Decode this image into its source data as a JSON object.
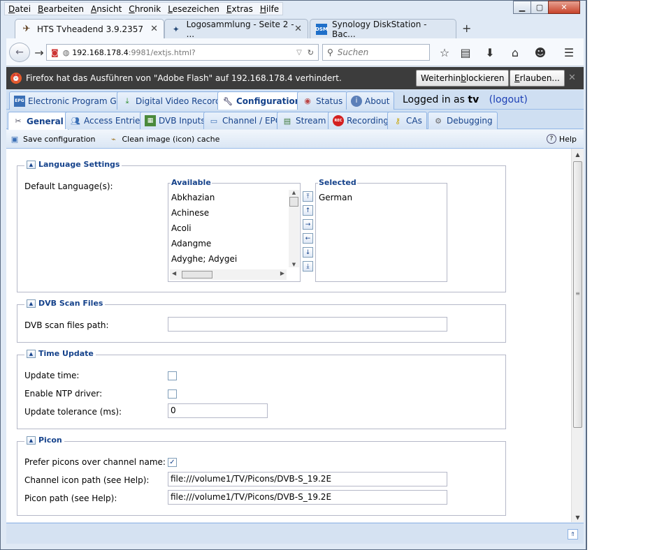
{
  "menu": [
    {
      "pre": "",
      "u": "D",
      "post": "atei"
    },
    {
      "pre": "",
      "u": "B",
      "post": "earbeiten"
    },
    {
      "pre": "",
      "u": "A",
      "post": "nsicht"
    },
    {
      "pre": "",
      "u": "C",
      "post": "hronik"
    },
    {
      "pre": "",
      "u": "L",
      "post": "esezeichen"
    },
    {
      "pre": "",
      "u": "E",
      "post": "xtras"
    },
    {
      "pre": "",
      "u": "H",
      "post": "ilfe"
    }
  ],
  "browser_tabs": [
    {
      "title": "HTS Tvheadend 3.9.2357"
    },
    {
      "title": "Logosammlung - Seite 2 - ..."
    },
    {
      "title": "Synology DiskStation - Bac..."
    }
  ],
  "tab_favicon_dsm": "DSM",
  "new_tab_symbol": "+",
  "url": {
    "host": "192.168.178.4",
    "rest": ":9981/extjs.html?"
  },
  "search_placeholder": "Suchen",
  "flash": {
    "message": "Firefox hat das Ausführen von \"Adobe Flash\" auf 192.168.178.4 verhindert.",
    "block_pre": "Weiterhin ",
    "block_u": "b",
    "block_post": "lockieren",
    "allow_u": "E",
    "allow_post": "rlauben..."
  },
  "main_tabs": [
    {
      "label": "Electronic Program Guide",
      "icon_text": "EPG"
    },
    {
      "label": "Digital Video Recorder"
    },
    {
      "label": "Configuration"
    },
    {
      "label": "Status"
    },
    {
      "label": "About"
    }
  ],
  "login": {
    "prefix": "Logged in as ",
    "user": "tv",
    "logout": "(logout)"
  },
  "sub_tabs": [
    {
      "label": "General"
    },
    {
      "label": "Access Entries"
    },
    {
      "label": "DVB Inputs"
    },
    {
      "label": "Channel / EPG"
    },
    {
      "label": "Stream"
    },
    {
      "label": "Recording",
      "icon_text": "REC"
    },
    {
      "label": "CAs"
    },
    {
      "label": "Debugging"
    }
  ],
  "toolbar": {
    "save": "Save configuration",
    "clean": "Clean image (icon) cache",
    "help": "Help"
  },
  "language": {
    "legend": "Language Settings",
    "label": "Default Language(s):",
    "available_title": "Available",
    "selected_title": "Selected",
    "available": [
      "Abkhazian",
      "Achinese",
      "Acoli",
      "Adangme",
      "Adyghe; Adygei"
    ],
    "selected": [
      "German"
    ]
  },
  "dvb": {
    "legend": "DVB Scan Files",
    "label": "DVB scan files path:",
    "value": ""
  },
  "time": {
    "legend": "Time Update",
    "update_time": "Update time:",
    "ntp": "Enable NTP driver:",
    "tolerance": "Update tolerance (ms):",
    "tolerance_value": "0",
    "update_time_checked": false,
    "ntp_checked": false
  },
  "picon": {
    "legend": "Picon",
    "prefer": "Prefer picons over channel name:",
    "prefer_checked": true,
    "check_mark": "✓",
    "channel_icon": "Channel icon path (see Help):",
    "channel_icon_value": "file:///volume1/TV/Picons/DVB-S_19.2E",
    "picon_path": "Picon path (see Help):",
    "picon_path_value": "file:///volume1/TV/Picons/DVB-S_19.2E"
  }
}
